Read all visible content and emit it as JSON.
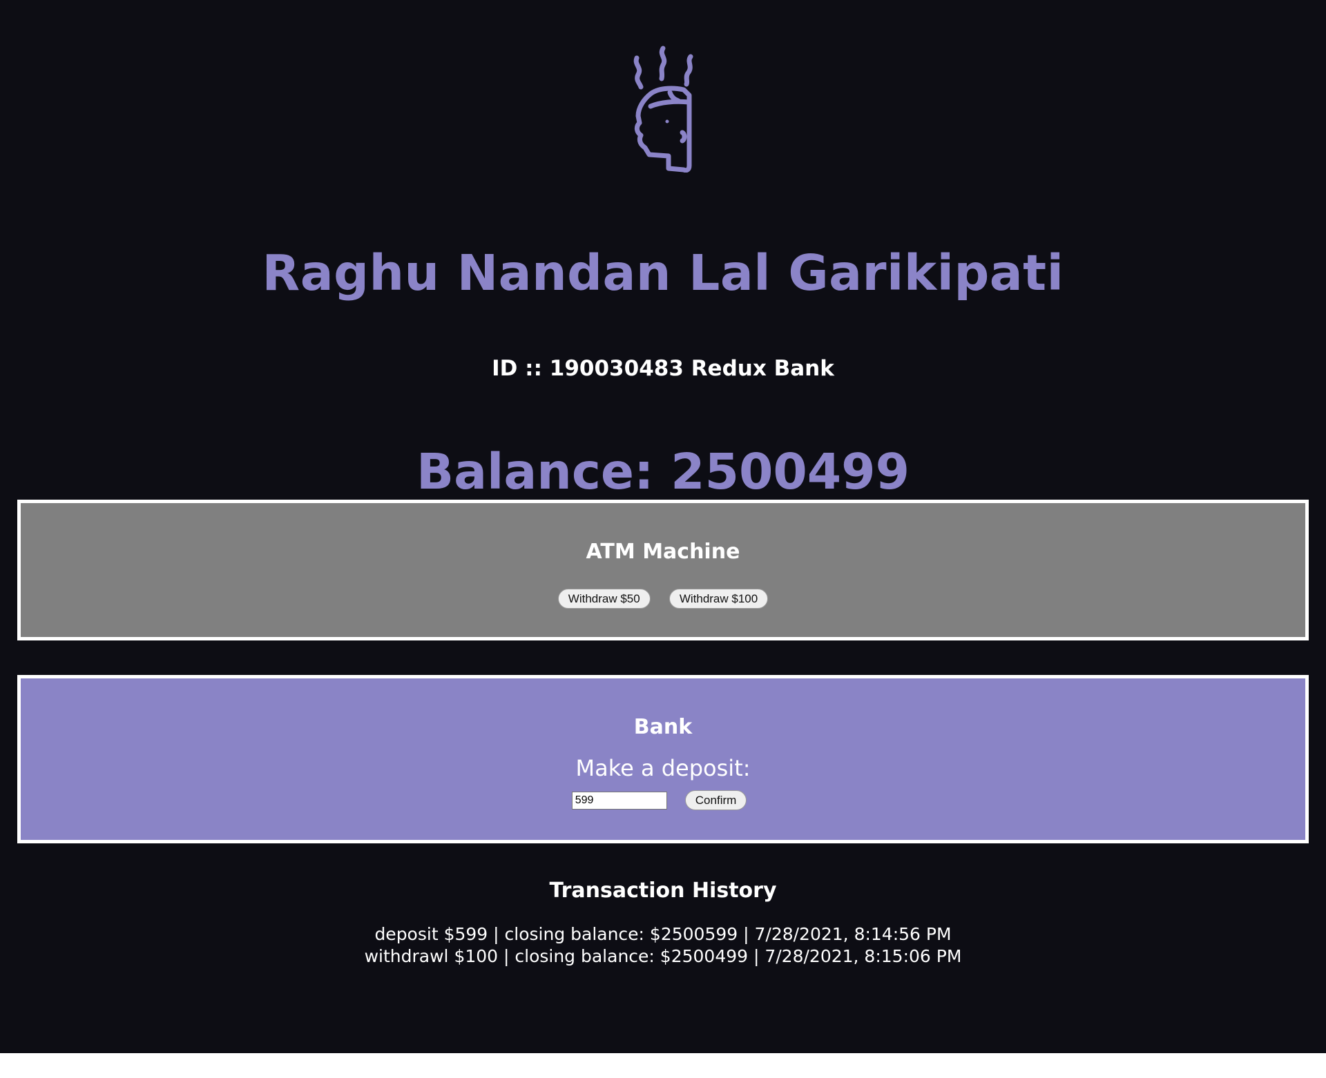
{
  "account": {
    "name": "Raghu Nandan Lal Garikipati",
    "id_line": "ID :: 190030483 Redux Bank",
    "balance_line": "Balance: 2500499"
  },
  "atm": {
    "title": "ATM Machine",
    "buttons": [
      "Withdraw $50",
      "Withdraw $100"
    ]
  },
  "bank": {
    "title": "Bank",
    "deposit_label": "Make a deposit:",
    "deposit_value": "599",
    "confirm_label": "Confirm"
  },
  "history": {
    "title": "Transaction History",
    "entries": [
      "deposit $599  |  closing balance: $2500599  |  7/28/2021, 8:14:56 PM",
      "withdrawl $100  |  closing balance: $2500499  |  7/28/2021, 8:15:06 PM"
    ]
  },
  "colors": {
    "background": "#0d0d14",
    "accent": "#8b84c8",
    "atm_panel": "#808080",
    "bank_panel": "#8a84c6"
  },
  "icons": {
    "logo": "steaming-head-icon"
  }
}
